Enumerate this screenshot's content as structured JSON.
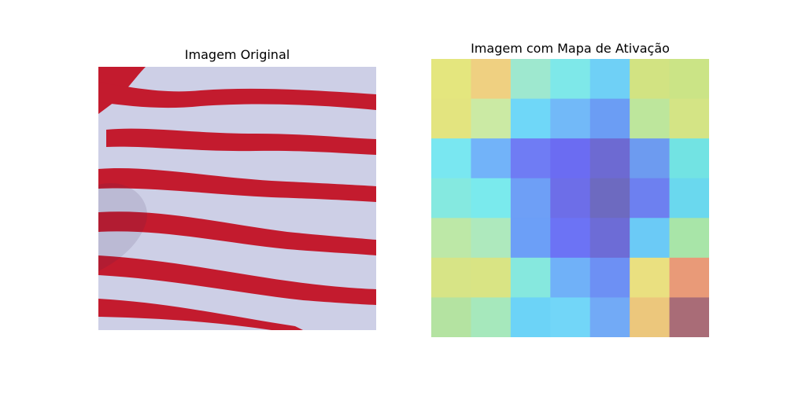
{
  "panels": {
    "original": {
      "title": "Imagem Original",
      "image_description": "Red and white horizontal striped fabric (shirt)"
    },
    "activation": {
      "title": "Imagem com Mapa de Ativação",
      "grid_size": [
        7,
        7
      ],
      "cell_colors": [
        [
          "#e4e67e",
          "#efd081",
          "#9ee8cf",
          "#7ee8e9",
          "#6fd0f6",
          "#d2e382",
          "#cbe486"
        ],
        [
          "#e3e47f",
          "#cbeaa4",
          "#6fd7f8",
          "#72b9f8",
          "#6b9df4",
          "#bde69c",
          "#d4e485"
        ],
        [
          "#79e7f1",
          "#72b3f9",
          "#6f7cf4",
          "#6b6cf2",
          "#6d6ad2",
          "#6d9bf0",
          "#72e3e3"
        ],
        [
          "#85e9e0",
          "#7aeaed",
          "#6e9ff6",
          "#6d6ee8",
          "#6d6ac0",
          "#6d80f0",
          "#6ad8ee"
        ],
        [
          "#bde8a7",
          "#aee9bd",
          "#6c9ff7",
          "#6c73f5",
          "#6d6cd6",
          "#6bcaf6",
          "#a8e5a8"
        ],
        [
          "#d7e486",
          "#d9e484",
          "#86e8de",
          "#70b1f8",
          "#6d90f4",
          "#eae080",
          "#e99a78"
        ],
        [
          "#b4e3a1",
          "#a6e8bc",
          "#6cd3f7",
          "#72d6f8",
          "#72aaf6",
          "#ecc77c",
          "#a96c77"
        ]
      ]
    }
  }
}
